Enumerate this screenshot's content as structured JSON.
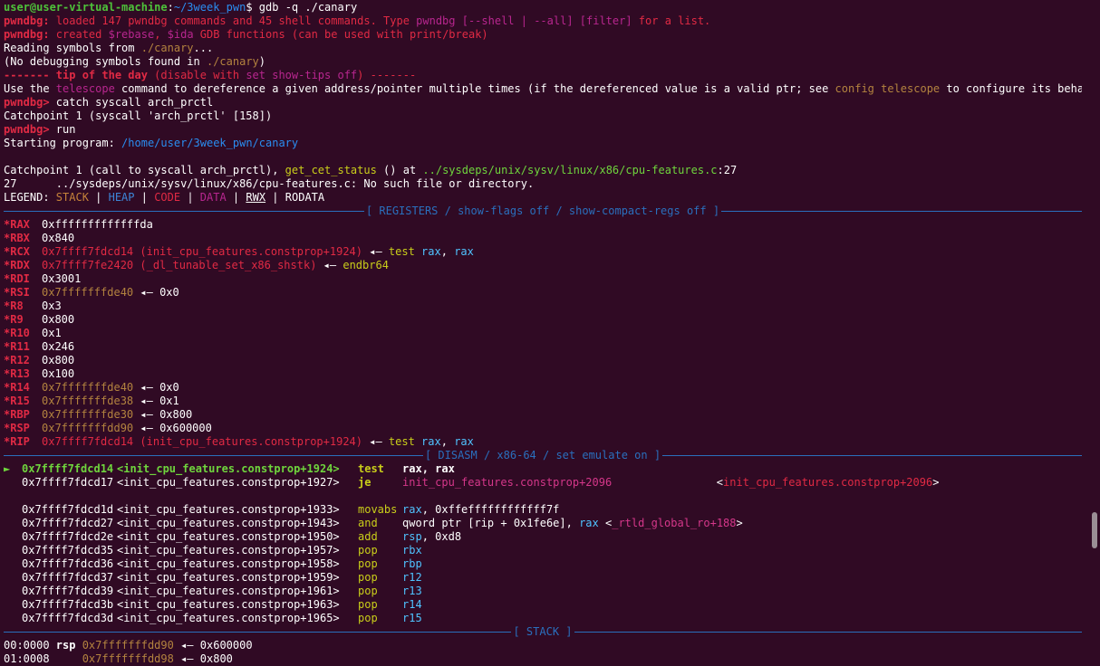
{
  "prompt": {
    "user_host": "user@user-virtual-machine",
    "colon": ":",
    "path": "~/3week_pwn",
    "dollar": "$",
    "command": " gdb -q ./canary"
  },
  "intro": {
    "l1_tag": "pwndbg:",
    "l1_a": " loaded 147 pwndbg commands and 45 shell commands. Type ",
    "l1_b": "pwndbg [--shell | --all] [filter]",
    "l1_c": " for a list.",
    "l2_tag": "pwndbg:",
    "l2_a": " created ",
    "l2_b": "$rebase",
    "l2_c": ", ",
    "l2_d": "$ida",
    "l2_e": " GDB functions (can be used with print/break)",
    "l3_a": "Reading symbols from ",
    "l3_b": "./canary",
    "l3_c": "...",
    "l4_a": "(No debugging symbols found in ",
    "l4_b": "./canary",
    "l4_c": ")",
    "l5_a": "------- ",
    "l5_b": "tip of the day",
    "l5_c": " (disable with ",
    "l5_d": "set show-tips off",
    "l5_e": ") -------",
    "l6_a": "Use the ",
    "l6_b": "telescope",
    "l6_c": " command to dereference a given address/pointer multiple times (if the dereferenced value is a valid ptr; see ",
    "l6_d": "config telescope",
    "l6_e": " to configure its behavior)",
    "l7_tag": "pwndbg>",
    "l7_cmd": " catch syscall arch_prctl",
    "l8": "Catchpoint 1 (syscall 'arch_prctl' [158])",
    "l9_tag": "pwndbg>",
    "l9_cmd": " run",
    "l10_a": "Starting program: ",
    "l10_b": "/home/user/3week_pwn/canary",
    "l11_a": "Catchpoint 1 (call to syscall arch_prctl), ",
    "l11_b": "get_cet_status",
    "l11_c": " () at ",
    "l11_d": "../sysdeps/unix/sysv/linux/x86/cpu-features.c",
    "l11_e": ":27",
    "l12": "27      ../sysdeps/unix/sysv/linux/x86/cpu-features.c: No such file or directory.",
    "legend_label": "LEGEND: ",
    "legend_stack": "STACK",
    "legend_heap": "HEAP",
    "legend_code": "CODE",
    "legend_data": "DATA",
    "legend_rwx": "RWX",
    "legend_rodata": "RODATA",
    "legend_sep": " | "
  },
  "sections": {
    "registers": "[ REGISTERS / show-flags off / show-compact-regs off ]",
    "disasm": "[ DISASM / x86-64 / set emulate on ]",
    "stack": "[ STACK ]"
  },
  "registers": [
    {
      "name": "*RAX",
      "value": "0xfffffffffffffda",
      "vcolor": "white",
      "rest": []
    },
    {
      "name": "*RBX",
      "value": "0x840",
      "vcolor": "white",
      "rest": []
    },
    {
      "name": "*RCX",
      "value": "0x7ffff7fdcd14 (init_cpu_features.constprop+1924)",
      "vcolor": "red",
      "arrow": " ◂— ",
      "rest": [
        [
          "test",
          "yellow"
        ],
        [
          " rax",
          "aqua"
        ],
        [
          ", ",
          "white"
        ],
        [
          "rax",
          "aqua"
        ]
      ]
    },
    {
      "name": "*RDX",
      "value": "0x7ffff7fe2420 (_dl_tunable_set_x86_shstk)",
      "vcolor": "red",
      "arrow": " ◂— ",
      "rest": [
        [
          "endbr64",
          "yellow"
        ]
      ]
    },
    {
      "name": "*RDI",
      "value": "0x3001",
      "vcolor": "white",
      "rest": []
    },
    {
      "name": "*RSI",
      "value": "0x7fffffffde40",
      "vcolor": "brown",
      "arrow": " ◂— ",
      "rest": [
        [
          "0x0",
          "white"
        ]
      ]
    },
    {
      "name": "*R8",
      "value": "0x3",
      "vcolor": "white",
      "rest": []
    },
    {
      "name": "*R9",
      "value": "0x800",
      "vcolor": "white",
      "rest": []
    },
    {
      "name": "*R10",
      "value": "0x1",
      "vcolor": "white",
      "rest": []
    },
    {
      "name": "*R11",
      "value": "0x246",
      "vcolor": "white",
      "rest": []
    },
    {
      "name": "*R12",
      "value": "0x800",
      "vcolor": "white",
      "rest": []
    },
    {
      "name": "*R13",
      "value": "0x100",
      "vcolor": "white",
      "rest": []
    },
    {
      "name": "*R14",
      "value": "0x7fffffffde40",
      "vcolor": "brown",
      "arrow": " ◂— ",
      "rest": [
        [
          "0x0",
          "white"
        ]
      ]
    },
    {
      "name": "*R15",
      "value": "0x7fffffffde38",
      "vcolor": "brown",
      "arrow": " ◂— ",
      "rest": [
        [
          "0x1",
          "white"
        ]
      ]
    },
    {
      "name": "*RBP",
      "value": "0x7fffffffde30",
      "vcolor": "brown",
      "arrow": " ◂— ",
      "rest": [
        [
          "0x800",
          "white"
        ]
      ]
    },
    {
      "name": "*RSP",
      "value": "0x7fffffffdd90",
      "vcolor": "brown",
      "arrow": " ◂— ",
      "rest": [
        [
          "0x600000",
          "white"
        ]
      ]
    },
    {
      "name": "*RIP",
      "value": "0x7ffff7fdcd14 (init_cpu_features.constprop+1924)",
      "vcolor": "red",
      "arrow": " ◂— ",
      "rest": [
        [
          "test",
          "yellow"
        ],
        [
          " rax",
          "aqua"
        ],
        [
          ", ",
          "white"
        ],
        [
          "rax",
          "aqua"
        ]
      ]
    }
  ],
  "disasm": [
    {
      "ptr": "►",
      "addr": "0x7ffff7fdcd14",
      "sym": "<init_cpu_features.constprop+1924>",
      "mn": "test",
      "ops": [
        [
          "rax",
          "whiteb"
        ],
        [
          ", ",
          "whiteb"
        ],
        [
          "rax",
          "whiteb"
        ]
      ],
      "current": true
    },
    {
      "ptr": "",
      "addr": "0x7ffff7fdcd17",
      "sym": "<init_cpu_features.constprop+1927>",
      "mn": "je",
      "ops": [
        [
          "init_cpu_features.constprop+2096",
          "pink"
        ],
        [
          "                <",
          "white"
        ],
        [
          "init_cpu_features.constprop+2096",
          "red"
        ],
        [
          ">",
          "white"
        ]
      ],
      "branch": true
    },
    {
      "blank": true
    },
    {
      "ptr": "",
      "addr": "0x7ffff7fdcd1d",
      "sym": "<init_cpu_features.constprop+1933>",
      "mn": "movabs",
      "ops": [
        [
          "rax",
          "aqua"
        ],
        [
          ", ",
          "white"
        ],
        [
          "0xffeffffffffffff7f",
          "white"
        ]
      ]
    },
    {
      "ptr": "",
      "addr": "0x7ffff7fdcd27",
      "sym": "<init_cpu_features.constprop+1943>",
      "mn": "and",
      "ops": [
        [
          "qword ptr [rip + 0x1fe6e]",
          "white"
        ],
        [
          ", ",
          "white"
        ],
        [
          "rax",
          "aqua"
        ],
        [
          " <",
          "white"
        ],
        [
          "_rtld_global_ro+188",
          "pink"
        ],
        [
          ">",
          "white"
        ]
      ]
    },
    {
      "ptr": "",
      "addr": "0x7ffff7fdcd2e",
      "sym": "<init_cpu_features.constprop+1950>",
      "mn": "add",
      "ops": [
        [
          "rsp",
          "aqua"
        ],
        [
          ", ",
          "white"
        ],
        [
          "0xd8",
          "white"
        ]
      ]
    },
    {
      "ptr": "",
      "addr": "0x7ffff7fdcd35",
      "sym": "<init_cpu_features.constprop+1957>",
      "mn": "pop",
      "ops": [
        [
          "rbx",
          "aqua"
        ]
      ]
    },
    {
      "ptr": "",
      "addr": "0x7ffff7fdcd36",
      "sym": "<init_cpu_features.constprop+1958>",
      "mn": "pop",
      "ops": [
        [
          "rbp",
          "aqua"
        ]
      ]
    },
    {
      "ptr": "",
      "addr": "0x7ffff7fdcd37",
      "sym": "<init_cpu_features.constprop+1959>",
      "mn": "pop",
      "ops": [
        [
          "r12",
          "aqua"
        ]
      ]
    },
    {
      "ptr": "",
      "addr": "0x7ffff7fdcd39",
      "sym": "<init_cpu_features.constprop+1961>",
      "mn": "pop",
      "ops": [
        [
          "r13",
          "aqua"
        ]
      ]
    },
    {
      "ptr": "",
      "addr": "0x7ffff7fdcd3b",
      "sym": "<init_cpu_features.constprop+1963>",
      "mn": "pop",
      "ops": [
        [
          "r14",
          "aqua"
        ]
      ]
    },
    {
      "ptr": "",
      "addr": "0x7ffff7fdcd3d",
      "sym": "<init_cpu_features.constprop+1965>",
      "mn": "pop",
      "ops": [
        [
          "r15",
          "aqua"
        ]
      ]
    }
  ],
  "stack": [
    {
      "idx": "00:0000",
      "reg": "rsp",
      "addr": "0x7fffffffdd90",
      "arrow": " ◂— ",
      "val": "0x600000"
    },
    {
      "idx": "01:0008",
      "reg": "",
      "addr": "0x7fffffffdd98",
      "arrow": " ◂— ",
      "val": "0x800"
    }
  ],
  "colors": {
    "background": "#300a24",
    "prompt_user": "#4ec23a",
    "prompt_path": "#2a8df0",
    "pwndbg_tag": "#e12a44",
    "register_name": "#e12a44",
    "section_line": "#2a6fbd",
    "mnemonic": "#c9ce1a",
    "operand": "#4fc3ff",
    "stack_address": "#b3833f"
  }
}
